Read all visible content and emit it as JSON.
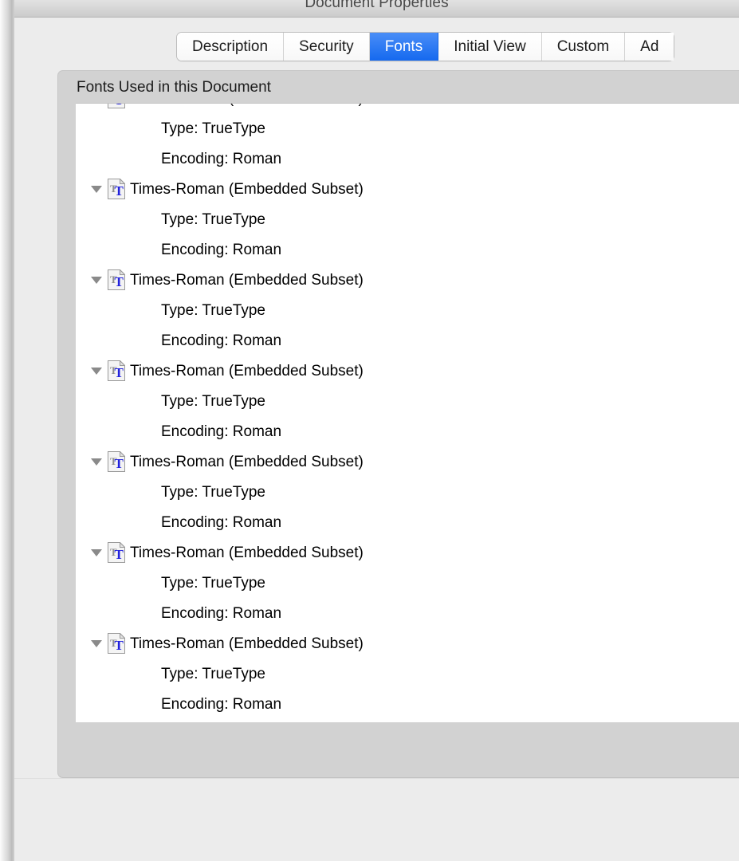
{
  "window": {
    "title": "Document Properties"
  },
  "tabs": [
    {
      "label": "Description",
      "selected": false
    },
    {
      "label": "Security",
      "selected": false
    },
    {
      "label": "Fonts",
      "selected": true
    },
    {
      "label": "Initial View",
      "selected": false
    },
    {
      "label": "Custom",
      "selected": false
    },
    {
      "label": "Ad",
      "selected": false
    }
  ],
  "fonts_panel": {
    "group_label": "Fonts Used in this Document",
    "entries": [
      {
        "name": "Times-Roman (Embedded Subset)",
        "type": "Type: TrueType",
        "encoding": "Encoding: Roman",
        "expanded": true
      },
      {
        "name": "Times-Roman (Embedded Subset)",
        "type": "Type: TrueType",
        "encoding": "Encoding: Roman",
        "expanded": true
      },
      {
        "name": "Times-Roman (Embedded Subset)",
        "type": "Type: TrueType",
        "encoding": "Encoding: Roman",
        "expanded": true
      },
      {
        "name": "Times-Roman (Embedded Subset)",
        "type": "Type: TrueType",
        "encoding": "Encoding: Roman",
        "expanded": true
      },
      {
        "name": "Times-Roman (Embedded Subset)",
        "type": "Type: TrueType",
        "encoding": "Encoding: Roman",
        "expanded": true
      },
      {
        "name": "Times-Roman (Embedded Subset)",
        "type": "Type: TrueType",
        "encoding": "Encoding: Roman",
        "expanded": true
      },
      {
        "name": "Times-Roman (Embedded Subset)",
        "type": "Type: TrueType",
        "encoding": "Encoding: Roman",
        "expanded": true
      }
    ]
  },
  "colors": {
    "accent_selected_tab": "#2f7bf3",
    "dialog_background": "#ececec",
    "groupbox_background": "#d2d2d2",
    "list_background": "#ffffff",
    "icon_letter_blue": "#2222dd",
    "disclosure_grey": "#8a8a8a"
  }
}
